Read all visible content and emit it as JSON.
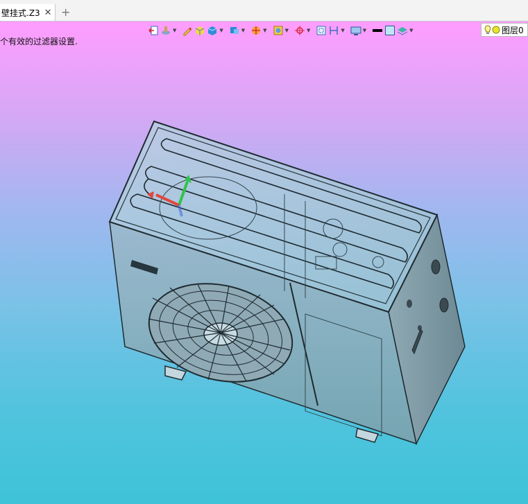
{
  "tab": {
    "title": "壁挂式.Z3",
    "close_glyph": "✕",
    "add_glyph": "+"
  },
  "viewport": {
    "message": "个有效的过滤器设置."
  },
  "toolbar": {
    "layer_label": "图层0",
    "items": [
      "back-icon",
      "paint-icon",
      "pencil-icon",
      "box-color-icon",
      "cube-icon",
      "view-cube-icon",
      "render-icon",
      "snapshot-icon",
      "target-icon",
      "frame-icon",
      "dimension-icon",
      "display-icon",
      "line-color-icon",
      "face-color-icon",
      "layer-icon",
      "bulb-icon"
    ]
  },
  "colors": {
    "gradient_top": "#ff9dff",
    "gradient_bottom": "#3ec3d8",
    "model_body": "#9ab8c4",
    "model_edge": "#1e2a30",
    "axis_x": "#e0483c",
    "axis_y": "#2ec44a",
    "axis_z": "#3b5bdc"
  }
}
